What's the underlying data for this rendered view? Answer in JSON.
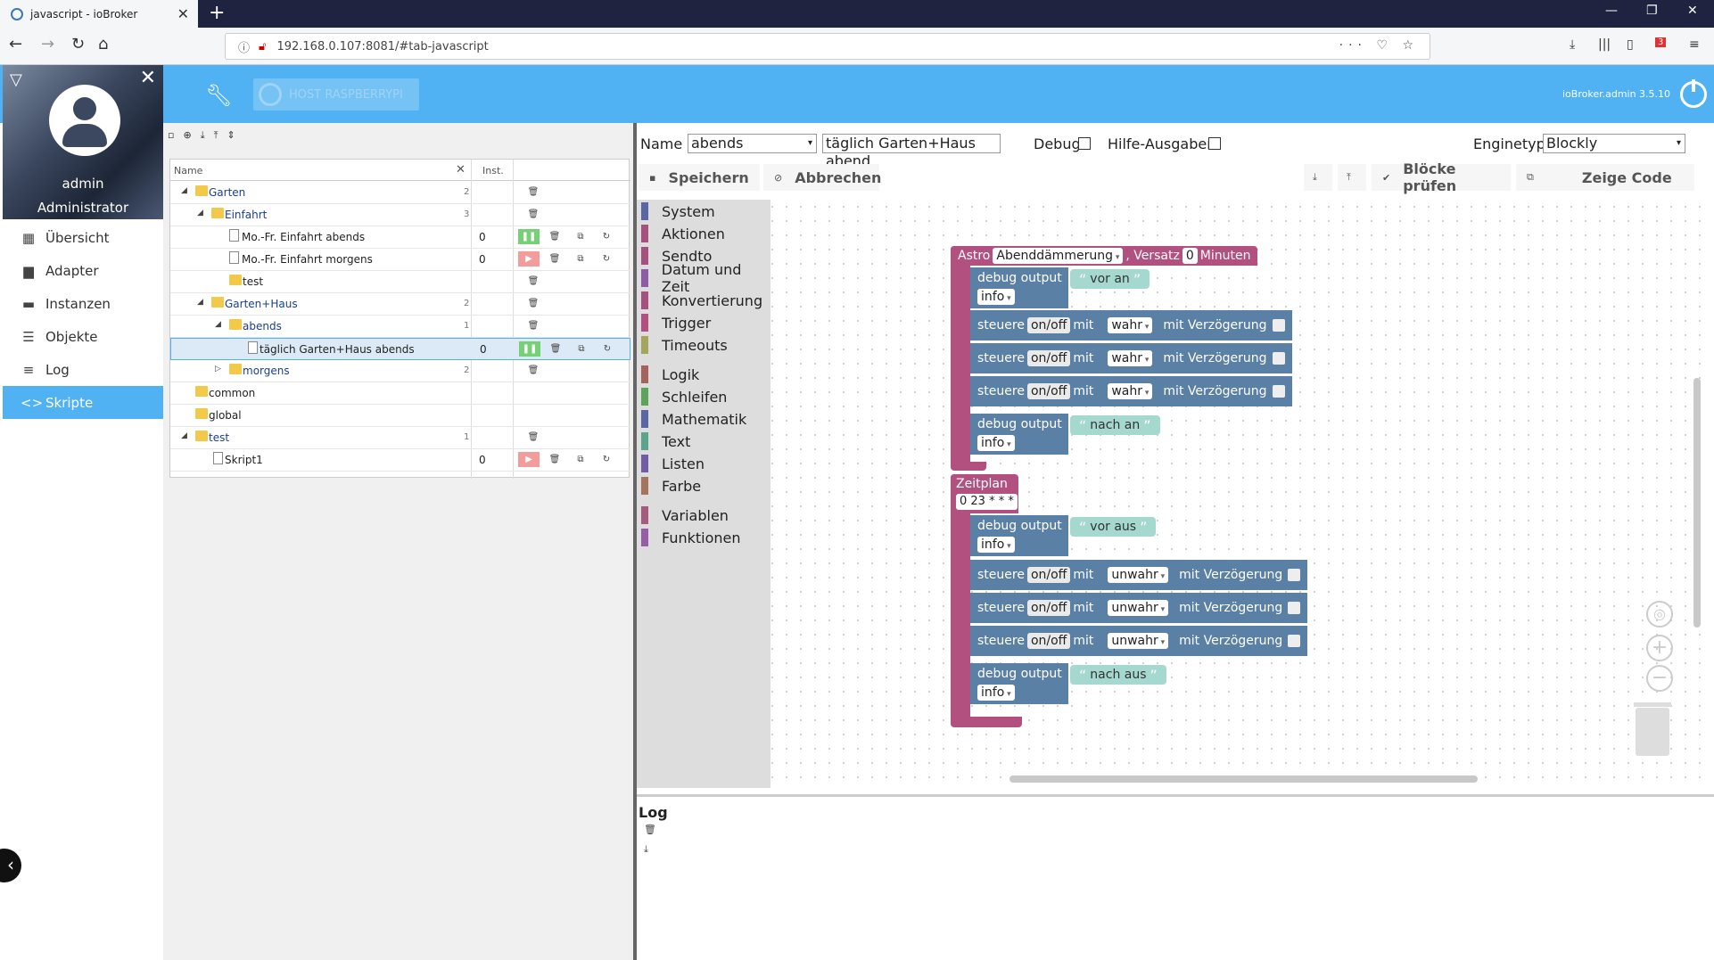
{
  "browser": {
    "tab_title": "javascript - ioBroker",
    "url": "192.168.0.107:8081/#tab-javascript",
    "badge": "3"
  },
  "app": {
    "host_label": "HOST RASPBERRYPI",
    "version": "ioBroker.admin 3.5.10"
  },
  "user": {
    "name": "admin",
    "role": "Administrator"
  },
  "sidebar": {
    "items": [
      {
        "label": "Übersicht",
        "icon": "grid-icon"
      },
      {
        "label": "Adapter",
        "icon": "store-icon"
      },
      {
        "label": "Instanzen",
        "icon": "instances-icon"
      },
      {
        "label": "Objekte",
        "icon": "list-icon"
      },
      {
        "label": "Log",
        "icon": "log-icon"
      },
      {
        "label": "Skripte",
        "icon": "code-icon",
        "active": true
      }
    ]
  },
  "tree": {
    "col_name": "Name",
    "col_inst": "Inst.",
    "rows": [
      {
        "label": "Garten",
        "count": "2"
      },
      {
        "label": "Einfahrt",
        "count": "3"
      },
      {
        "label": "Mo.-Fr. Einfahrt abends",
        "inst": "0"
      },
      {
        "label": "Mo.-Fr. Einfahrt morgens",
        "inst": "0"
      },
      {
        "label": "test"
      },
      {
        "label": "Garten+Haus",
        "count": "2"
      },
      {
        "label": "abends",
        "count": "1"
      },
      {
        "label": "täglich Garten+Haus abends",
        "inst": "0"
      },
      {
        "label": "morgens",
        "count": "2"
      },
      {
        "label": "common"
      },
      {
        "label": "global"
      },
      {
        "label": "test",
        "count": "1"
      },
      {
        "label": "Skript1",
        "inst": "0"
      }
    ]
  },
  "editor": {
    "name_label": "Name",
    "folder_value": "abends",
    "script_name": "täglich Garten+Haus abend",
    "debug_label": "Debug",
    "help_label": "Hilfe-Ausgaben",
    "engine_label": "Enginetyp",
    "engine_value": "Blockly",
    "save_label": "Speichern",
    "cancel_label": "Abbrechen",
    "check_label": "Blöcke prüfen",
    "code_label": "Zeige Code"
  },
  "toolbox": {
    "categories": [
      {
        "label": "System",
        "color": "#5b67a5"
      },
      {
        "label": "Aktionen",
        "color": "#a5507f"
      },
      {
        "label": "Sendto",
        "color": "#a5507f"
      },
      {
        "label": "Datum und Zeit",
        "color": "#8e5ba5"
      },
      {
        "label": "Konvertierung",
        "color": "#a5507f"
      },
      {
        "label": "Trigger",
        "color": "#b2507f"
      },
      {
        "label": "Timeouts",
        "color": "#a5a55b"
      },
      {
        "label": "Logik",
        "color": "#a5635b"
      },
      {
        "label": "Schleifen",
        "color": "#5ba55b"
      },
      {
        "label": "Mathematik",
        "color": "#5b67a5"
      },
      {
        "label": "Text",
        "color": "#5ba58c"
      },
      {
        "label": "Listen",
        "color": "#745ba5"
      },
      {
        "label": "Farbe",
        "color": "#a5745b"
      },
      {
        "label": "Variablen",
        "color": "#a55b80"
      },
      {
        "label": "Funktionen",
        "color": "#995ba5"
      }
    ]
  },
  "blocks": {
    "astro": {
      "kw": "Astro",
      "event": "Abenddämmerung",
      "offset_kw": ", Versatz",
      "offset": "0",
      "unit": "Minuten"
    },
    "zeitplan": {
      "kw": "Zeitplan",
      "cron": "0 23 * * *"
    },
    "debug_kw": "debug output",
    "info": "info",
    "steuere_kw": "steuere",
    "onoff": "on/off",
    "mit": "mit",
    "delay": "mit Verzögerung",
    "wahr": "wahr",
    "unwahr": "unwahr",
    "msg_vor_an": "vor an",
    "msg_nach_an": "nach an",
    "msg_vor_aus": "vor aus",
    "msg_nach_aus": "nach aus"
  },
  "log": {
    "title": "Log"
  }
}
